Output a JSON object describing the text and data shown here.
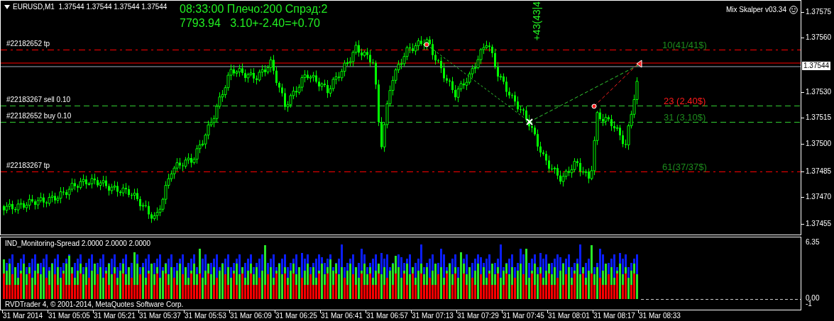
{
  "chart": {
    "title": "EURUSD,M1  1.37544 1.37544 1.37544 1.37544",
    "info_lines": [
      "08:33:00 Плечо:200 Спрэд:2",
      "7793.94   3.10+-2.40=+0.70"
    ],
    "expert": "Mix Skalper v03.34",
    "trade_summary": "+43(43|4",
    "order_lines": [
      {
        "label": "#22182652 tp",
        "kind": "tp",
        "note": "10(41/41$)",
        "color": "#1d8a1d"
      },
      {
        "label": "#22183267 sell 0.10",
        "kind": "sell",
        "note": "23 (2.40$)",
        "color": "#ff1a1a"
      },
      {
        "label": "#22182652 buy 0.10",
        "kind": "buy",
        "note": "31 (3.10$)",
        "color": "#1d8a1d"
      },
      {
        "label": "#22183267 tp",
        "kind": "tp",
        "note": "61(37/37$)",
        "color": "#1d8a1d"
      }
    ]
  },
  "price_axis": {
    "ticks": [
      "1.37575",
      "1.37560",
      "1.37530",
      "1.37515",
      "1.37500",
      "1.37485",
      "1.37470",
      "1.37455"
    ],
    "current_price": "1.37544"
  },
  "indicator": {
    "title": "IND_Monitoring-Spread 2.0000 2.0000 2.0000",
    "copyright": "RVDTrader 4, © 2001-2014, MetaQuotes Software Corp.",
    "scale": [
      "6.35",
      "0.00",
      "-1"
    ]
  },
  "time_axis": [
    "31 Mar 2014",
    "31 Mar 05:05",
    "31 Mar 05:21",
    "31 Mar 05:37",
    "31 Mar 05:53",
    "31 Mar 06:09",
    "31 Mar 06:25",
    "31 Mar 06:41",
    "31 Mar 06:57",
    "31 Mar 07:13",
    "31 Mar 07:29",
    "31 Mar 07:45",
    "31 Mar 08:01",
    "31 Mar 08:17",
    "31 Mar 08:33"
  ]
}
